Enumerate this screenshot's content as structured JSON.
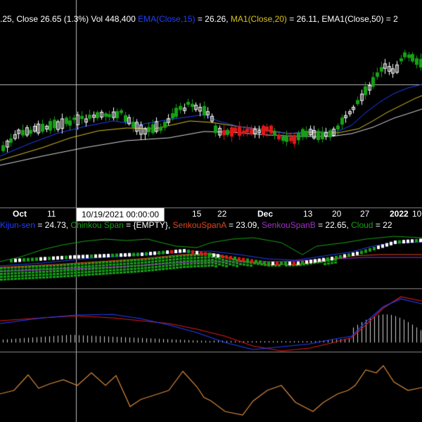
{
  "colors": {
    "background": "#000000",
    "up_candle": "#16a016",
    "down_candle": "#e01818",
    "neutral_candle": "#ffffff",
    "ema15": "#1f3fff",
    "ma20": "#d8c21a",
    "ema50": "#d8d8d8",
    "kijun": "#1f3fff",
    "chinkou": "#16a016",
    "senkou_a": "#e0461e",
    "senkou_b": "#a030c8",
    "cloud": "#16a016",
    "oscillator": "#d88a3a",
    "macd_line": "#1f3fff",
    "signal_line": "#e01818",
    "separator": "#888888",
    "crosshair": "#bbbbbb"
  },
  "header": {
    "stats_text": ".25, Close 26.65 (1.3%) Vol 448,400",
    "ema_label": "EMA(Close,15)",
    "ema_value": " = 26.26,",
    "ma_label": "MA1(Close,20)",
    "ma_value": " = 26.11,",
    "ema50_text": "EMA1(Close,50) = 2"
  },
  "ichimoku_legend": {
    "kijun_label": "Kijun-sen",
    "kijun_value": " = 24.73,",
    "chinkou_label": "Chinkou Span",
    "chinkou_value": " = {EMPTY},",
    "senkou_a_label": "SenkouSpanA",
    "senkou_a_value": " = 23.09,",
    "senkou_b_label": "SenkouSpanB",
    "senkou_b_value": " = 22.65,",
    "cloud_label": "Cloud",
    "cloud_value": " = 22"
  },
  "x_axis_labels": [
    {
      "text": "Oct",
      "bold": true
    },
    {
      "text": "11",
      "bold": false
    },
    {
      "text": "15",
      "bold": false
    },
    {
      "text": "22",
      "bold": false
    },
    {
      "text": "Dec",
      "bold": true
    },
    {
      "text": "13",
      "bold": false
    },
    {
      "text": "20",
      "bold": false
    },
    {
      "text": "27",
      "bold": false
    },
    {
      "text": "2022",
      "bold": true
    },
    {
      "text": "10",
      "bold": false
    }
  ],
  "crosshair_date": "10/19/2021 00:00:00",
  "chart_data": {
    "type": "candlestick",
    "series": [
      {
        "name": "EMA(Close,15)"
      },
      {
        "name": "MA1(Close,20)"
      },
      {
        "name": "EMA1(Close,50)"
      }
    ],
    "last": {
      "close": 26.65,
      "change_pct": 1.3,
      "volume": 448400
    }
  }
}
